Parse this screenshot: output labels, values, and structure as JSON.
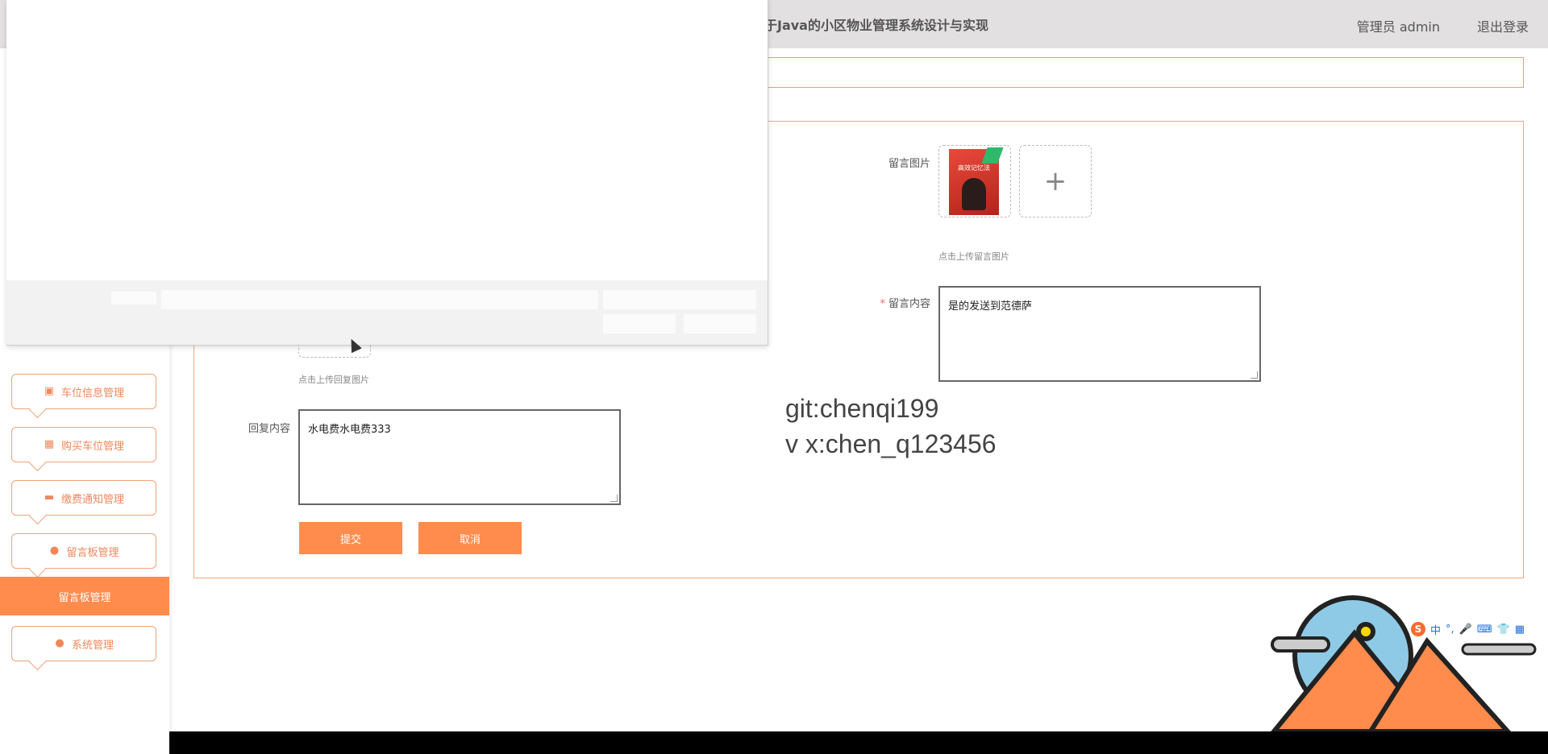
{
  "header": {
    "title": "于Java的小区物业管理系统设计与实现",
    "user_label": "管理员 admin",
    "logout_label": "退出登录"
  },
  "sidebar": {
    "items": [
      {
        "label": "车位信息管理",
        "icon": "clipboard-icon"
      },
      {
        "label": "购买车位管理",
        "icon": "grid-icon"
      },
      {
        "label": "缴费通知管理",
        "icon": "wallet-icon"
      },
      {
        "label": "留言板管理",
        "icon": "user-icon"
      },
      {
        "label": "系统管理",
        "icon": "user-icon"
      }
    ],
    "active_item": "留言板管理"
  },
  "form": {
    "message_image_label": "留言图片",
    "message_image_hint": "点击上传留言图片",
    "message_content_label": "留言内容",
    "message_content_value": "是的发送到范德萨",
    "reply_image_hint": "点击上传回复图片",
    "reply_content_label": "回复内容",
    "reply_content_value": "水电费水电费333",
    "submit_label": "提交",
    "cancel_label": "取消",
    "book_cover_text": "高效记忆法"
  },
  "watermark": {
    "line1": "git:chenqi199",
    "line2": "v x:chen_q123456"
  },
  "ime": {
    "logo": "S",
    "mode": "中"
  }
}
